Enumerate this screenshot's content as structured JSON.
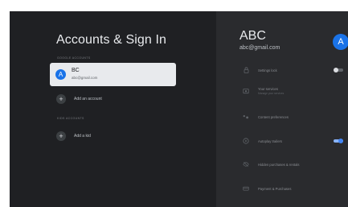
{
  "left": {
    "title": "Accounts & Sign In",
    "section_accounts_label": "Google Accounts",
    "account": {
      "initial": "A",
      "name": "BC",
      "email": "abc@gmail.com"
    },
    "add_account_label": "Add an account",
    "section_kids_label": "Kids accounts",
    "add_kid_label": "Add a kid"
  },
  "right": {
    "name": "ABC",
    "email": "abc@gmail.com",
    "initial": "A",
    "settings": [
      {
        "icon": "lock-icon",
        "label": "Settings lock",
        "sublabel": "",
        "toggle": "off"
      },
      {
        "icon": "payment-icon",
        "label": "Your services",
        "sublabel": "Manage your services",
        "toggle": ""
      },
      {
        "icon": "preferences-icon",
        "label": "Content preferences",
        "sublabel": "",
        "toggle": ""
      },
      {
        "icon": "play-icon",
        "label": "Autoplay trailers",
        "sublabel": "",
        "toggle": "on"
      },
      {
        "icon": "eye-off-icon",
        "label": "Hidden purchases & rentals",
        "sublabel": "",
        "toggle": ""
      },
      {
        "icon": "card-icon",
        "label": "Payment & Purchases",
        "sublabel": "",
        "toggle": ""
      }
    ]
  },
  "colors": {
    "accent": "#1a73e8",
    "toggle_on": "#4285f4"
  }
}
